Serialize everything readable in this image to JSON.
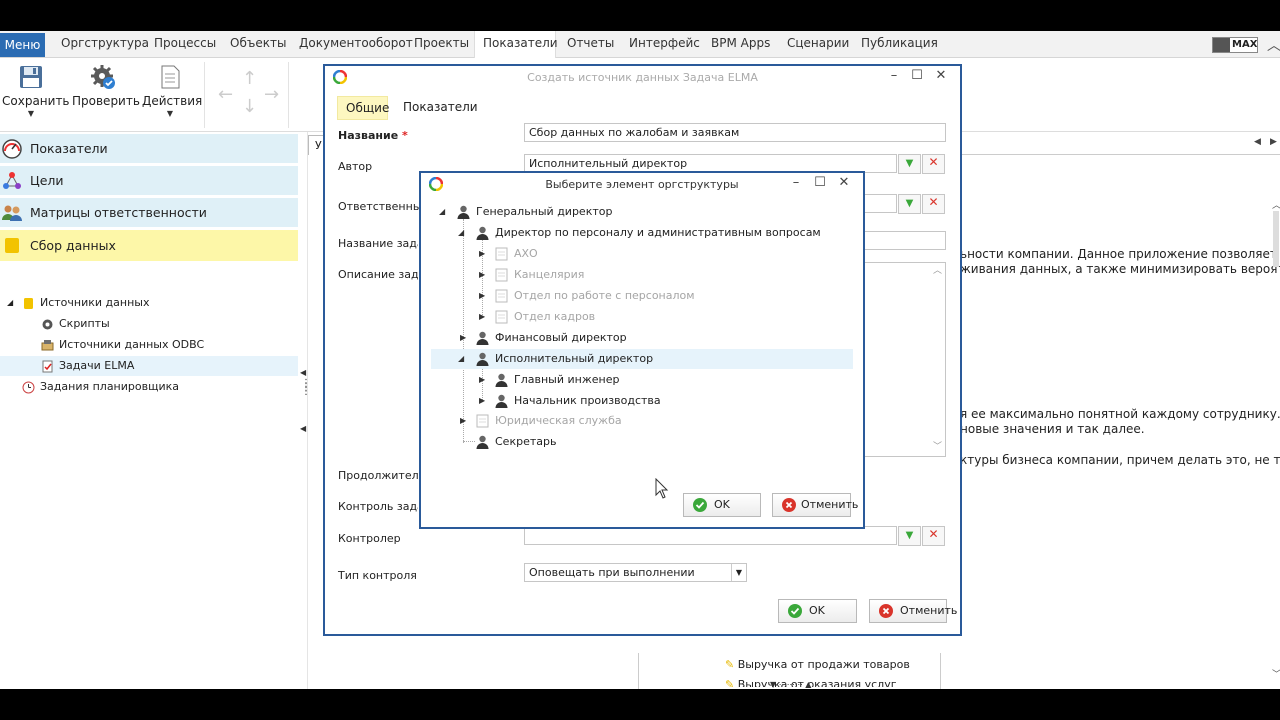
{
  "menubar": {
    "menu_label": "Меню",
    "items": [
      "Оргструктура",
      "Процессы",
      "Объекты",
      "Документооборот",
      "Проекты",
      "Показатели",
      "Отчеты",
      "Интерфейс",
      "BPM Apps",
      "Сценарии",
      "Публикация"
    ],
    "active": "Показатели",
    "max_label": "MAX"
  },
  "toolbar": {
    "save_label": "Сохранить",
    "check_label": "Проверить",
    "actions_label": "Действия"
  },
  "sidebar": {
    "sections": [
      {
        "label": "Показатели",
        "icon": "gauge-icon"
      },
      {
        "label": "Цели",
        "icon": "goals-icon"
      },
      {
        "label": "Матрицы ответственности",
        "icon": "users-icon"
      },
      {
        "label": "Сбор данных",
        "icon": "folder-icon",
        "selected": true
      }
    ],
    "tree": [
      {
        "label": "Источники данных",
        "icon": "folder-icon"
      },
      {
        "label": "Скрипты",
        "icon": "gear-icon"
      },
      {
        "label": "Источники данных ODBC",
        "icon": "odbc-icon"
      },
      {
        "label": "Задачи ELMA",
        "icon": "task-icon",
        "selected": true
      },
      {
        "label": "Задания планировщика",
        "icon": "clock-icon"
      }
    ]
  },
  "background": {
    "tab_label": "У",
    "text1": "ьности компании. Данное приложение позволяет",
    "text2": "живания данных, а также минимизировать вероятность",
    "text3": "я ее максимально понятной каждому сотруднику. Для",
    "text4": "новые значения и так далее.",
    "text5": "ктуры бизнеса компании, причем делать это, не теряя",
    "list1": "Выручка от продажи товаров",
    "list2": "Выручка от оказания услуг"
  },
  "main_dialog": {
    "title": "Создать источник данных Задача ELMA",
    "tabs": [
      "Общие",
      "Показатели"
    ],
    "fields": {
      "name_label": "Название",
      "required_mark": "*",
      "name_value": "Сбор данных по жалобам и заявкам",
      "author_label": "Автор",
      "author_value": "Исполнительный директор",
      "responsible_label": "Ответственный",
      "task_name_label": "Название задачи",
      "task_desc_label": "Описание задачи",
      "duration_label": "Продолжительность",
      "control_label": "Контроль задачи",
      "controller_label": "Контролер",
      "control_type_label": "Тип контроля",
      "control_type_value": "Оповещать при выполнении"
    },
    "ok_label": "OK",
    "cancel_label": "Отменить"
  },
  "org_dialog": {
    "title": "Выберите элемент оргструктуры",
    "tree": {
      "root": "Генеральный директор",
      "hr_director": "Директор по персоналу и административным вопросам",
      "hr_children": [
        "АХО",
        "Канцелярия",
        "Отдел по работе с персоналом",
        "Отдел кадров"
      ],
      "finance_director": "Финансовый директор",
      "executive_director": "Исполнительный директор",
      "exec_children": [
        "Главный инженер",
        "Начальник производства"
      ],
      "legal": "Юридическая служба",
      "secretary": "Секретарь"
    },
    "ok_label": "OK",
    "cancel_label": "Отменить"
  },
  "colors": {
    "accent": "#2b6cb3",
    "dialog_border": "#2a5a9a",
    "selection": "#fdf7a8",
    "sidebar_bg": "#dff0f7",
    "ok_green": "#3aa83a",
    "cancel_red": "#d9342b"
  }
}
